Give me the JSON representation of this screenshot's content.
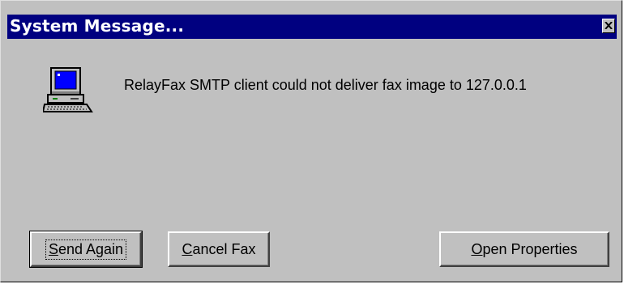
{
  "dialog": {
    "title": "System Message...",
    "message": "RelayFax SMTP client could not deliver fax image to 127.0.0.1",
    "icon": "computer-icon"
  },
  "buttons": {
    "send_again": {
      "mnemonic": "S",
      "rest": "end Again"
    },
    "cancel_fax": {
      "mnemonic": "C",
      "rest": "ancel Fax"
    },
    "open_properties": {
      "mnemonic": "O",
      "rest": "pen Properties"
    }
  },
  "colors": {
    "titlebar": "#000080",
    "face": "#c0c0c0",
    "title_text": "#ffffff"
  }
}
